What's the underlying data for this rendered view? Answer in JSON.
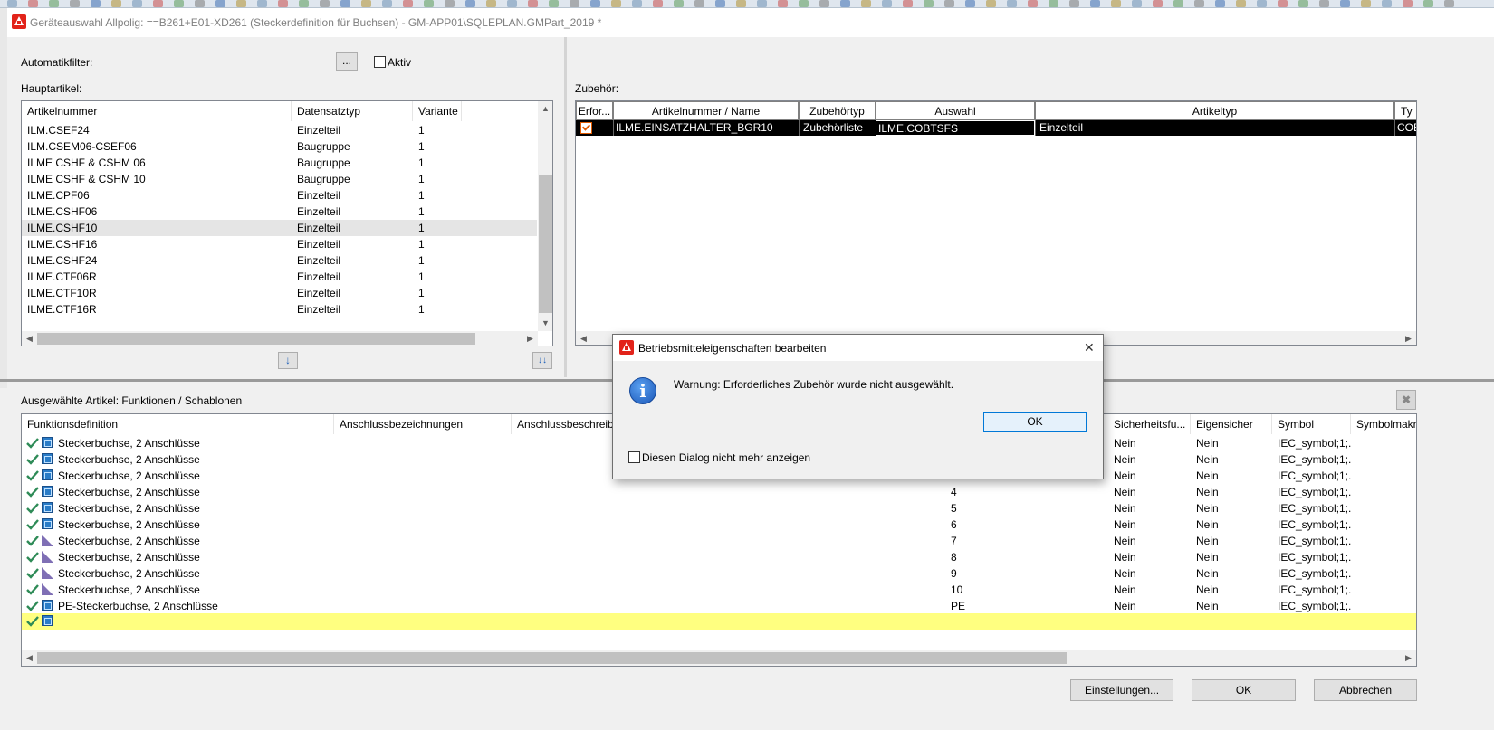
{
  "window": {
    "title": "Geräteauswahl Allpolig: ==B261+E01-XD261 (Steckerdefinition für Buchsen) - GM-APP01\\SQLEPLAN.GMPart_2019 *"
  },
  "filter": {
    "label": "Automatikfilter:",
    "browse_label": "...",
    "active_label": "Aktiv"
  },
  "haupt": {
    "label": "Hauptartikel:",
    "columns": [
      "Artikelnummer",
      "Datensatztyp",
      "Variante"
    ],
    "rows": [
      [
        "ILM.CSEF24",
        "Einzelteil",
        "1"
      ],
      [
        "ILM.CSEM06-CSEF06",
        "Baugruppe",
        "1"
      ],
      [
        "ILME CSHF & CSHM 06",
        "Baugruppe",
        "1"
      ],
      [
        "ILME CSHF & CSHM 10",
        "Baugruppe",
        "1"
      ],
      [
        "ILME.CPF06",
        "Einzelteil",
        "1"
      ],
      [
        "ILME.CSHF06",
        "Einzelteil",
        "1"
      ],
      [
        "ILME.CSHF10",
        "Einzelteil",
        "1"
      ],
      [
        "ILME.CSHF16",
        "Einzelteil",
        "1"
      ],
      [
        "ILME.CSHF24",
        "Einzelteil",
        "1"
      ],
      [
        "ILME.CTF06R",
        "Einzelteil",
        "1"
      ],
      [
        "ILME.CTF10R",
        "Einzelteil",
        "1"
      ],
      [
        "ILME.CTF16R",
        "Einzelteil",
        "1"
      ]
    ],
    "selected_row": 6
  },
  "zubehoer": {
    "label": "Zubehör:",
    "columns": [
      "Erfor...",
      "Artikelnummer / Name",
      "Zubehörtyp",
      "Auswahl",
      "Artikeltyp",
      "Ty"
    ],
    "row": [
      "",
      "ILME.EINSATZHALTER_BGR10",
      "Zubehörliste",
      "ILME.COBTSFS",
      "Einzelteil",
      "COB"
    ]
  },
  "ausgewaehlt": {
    "label": "Ausgewählte Artikel: Funktionen / Schablonen",
    "columns": [
      "Funktionsdefinition",
      "Anschlussbezeichnungen",
      "Anschlussbeschreibu",
      "Sicherheitsfu...",
      "Eigensicher",
      "Symbol",
      "Symbolmakr"
    ],
    "rows": [
      {
        "icon": "blue",
        "func": "Steckerbuchse, 2 Anschlüsse",
        "num": "",
        "sich": "Nein",
        "eigen": "Nein",
        "symbol": "IEC_symbol;1;..."
      },
      {
        "icon": "blue",
        "func": "Steckerbuchse, 2 Anschlüsse",
        "num": "",
        "sich": "Nein",
        "eigen": "Nein",
        "symbol": "IEC_symbol;1;..."
      },
      {
        "icon": "blue",
        "func": "Steckerbuchse, 2 Anschlüsse",
        "num": "",
        "sich": "Nein",
        "eigen": "Nein",
        "symbol": "IEC_symbol;1;..."
      },
      {
        "icon": "blue",
        "func": "Steckerbuchse, 2 Anschlüsse",
        "num": "4",
        "sich": "Nein",
        "eigen": "Nein",
        "symbol": "IEC_symbol;1;..."
      },
      {
        "icon": "blue",
        "func": "Steckerbuchse, 2 Anschlüsse",
        "num": "5",
        "sich": "Nein",
        "eigen": "Nein",
        "symbol": "IEC_symbol;1;..."
      },
      {
        "icon": "blue",
        "func": "Steckerbuchse, 2 Anschlüsse",
        "num": "6",
        "sich": "Nein",
        "eigen": "Nein",
        "symbol": "IEC_symbol;1;..."
      },
      {
        "icon": "tri",
        "func": "Steckerbuchse, 2 Anschlüsse",
        "num": "7",
        "sich": "Nein",
        "eigen": "Nein",
        "symbol": "IEC_symbol;1;..."
      },
      {
        "icon": "tri",
        "func": "Steckerbuchse, 2 Anschlüsse",
        "num": "8",
        "sich": "Nein",
        "eigen": "Nein",
        "symbol": "IEC_symbol;1;..."
      },
      {
        "icon": "tri",
        "func": "Steckerbuchse, 2 Anschlüsse",
        "num": "9",
        "sich": "Nein",
        "eigen": "Nein",
        "symbol": "IEC_symbol;1;..."
      },
      {
        "icon": "tri",
        "func": "Steckerbuchse, 2 Anschlüsse",
        "num": "10",
        "sich": "Nein",
        "eigen": "Nein",
        "symbol": "IEC_symbol;1;..."
      },
      {
        "icon": "blue",
        "func": "PE-Steckerbuchse, 2 Anschlüsse",
        "num": "PE",
        "sich": "Nein",
        "eigen": "Nein",
        "symbol": "IEC_symbol;1;..."
      }
    ]
  },
  "footer": {
    "settings_label": "Einstellungen...",
    "ok_label": "OK",
    "cancel_label": "Abbrechen"
  },
  "dialog": {
    "title": "Betriebsmitteleigenschaften bearbeiten",
    "close_glyph": "✕",
    "message": "Warnung: Erforderliches Zubehör wurde nicht ausgewählt.",
    "ok_label": "OK",
    "dont_show_label": "Diesen Dialog nicht mehr anzeigen"
  },
  "icons": [
    "eplan-logo-icon",
    "ellipsis-icon",
    "arrow-down-icon",
    "double-arrow-down-icon",
    "checkmark-icon",
    "function-icon",
    "template-icon",
    "info-icon",
    "close-icon",
    "clear-icon"
  ],
  "colors": {
    "selection": "#000000",
    "highlight_row": "#ffff80",
    "check_green": "#2e8b57",
    "accent_orange": "#e05a00",
    "logo_red": "#e2231a"
  }
}
